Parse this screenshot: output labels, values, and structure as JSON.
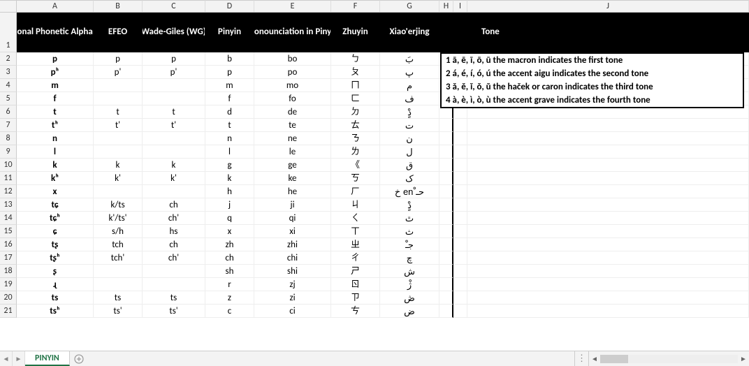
{
  "sheet": {
    "active_tab": "PINYIN"
  },
  "columns": {
    "letters": [
      "A",
      "B",
      "C",
      "D",
      "E",
      "F",
      "G",
      "H",
      "I",
      "J"
    ]
  },
  "headers": {
    "A": "International Phonetic Alphabet (IPA)",
    "B": "EFEO",
    "C": "Wade-Giles (WG)",
    "D": "Pinyin",
    "E": "Pronounciation in Pinyin",
    "F": "Zhuyin",
    "G": "Xiao'erjing",
    "J": "Tone"
  },
  "data_rows": [
    {
      "n": 2,
      "A": "p",
      "B": "p",
      "C": "p",
      "D": "b",
      "E": "bo",
      "F": "ㄅ",
      "G": "بَ"
    },
    {
      "n": 3,
      "A": "pʰ",
      "B": "p'",
      "C": "p'",
      "D": "p",
      "E": "po",
      "F": "ㄆ",
      "G": "پ"
    },
    {
      "n": 4,
      "A": "m",
      "B": "",
      "C": "",
      "D": "m",
      "E": "mo",
      "F": "ㄇ",
      "G": "م"
    },
    {
      "n": 5,
      "A": "f",
      "B": "",
      "C": "",
      "D": "f",
      "E": "fo",
      "F": "ㄈ",
      "G": "ف"
    },
    {
      "n": 6,
      "A": "t",
      "B": "t",
      "C": "t",
      "D": "d",
      "E": "de",
      "F": "ㄉ",
      "G": "دٍْ"
    },
    {
      "n": 7,
      "A": "tʰ",
      "B": "t'",
      "C": "t'",
      "D": "t",
      "E": "te",
      "F": "ㄊ",
      "G": "ت"
    },
    {
      "n": 8,
      "A": "n",
      "B": "",
      "C": "",
      "D": "n",
      "E": "ne",
      "F": "ㄋ",
      "G": "ن"
    },
    {
      "n": 9,
      "A": "l",
      "B": "",
      "C": "",
      "D": "l",
      "E": "le",
      "F": "ㄌ",
      "G": "ل"
    },
    {
      "n": 10,
      "A": "k",
      "B": "k",
      "C": "k",
      "D": "g",
      "E": "ge",
      "F": "《",
      "G": "ق"
    },
    {
      "n": 11,
      "A": "kʰ",
      "B": "k'",
      "C": "k'",
      "D": "k",
      "E": "ke",
      "F": "ㄎ",
      "G": "ک"
    },
    {
      "n": 12,
      "A": "x",
      "B": "",
      "C": "",
      "D": "h",
      "E": "he",
      "F": "ㄏ",
      "G": "خ en ْحـ"
    },
    {
      "n": 13,
      "A": "tɕ",
      "B": "k/ts",
      "C": "ch",
      "D": "j",
      "E": "ji",
      "F": "ㄐ",
      "G": "دٍْ"
    },
    {
      "n": 14,
      "A": "tɕʰ",
      "B": "k'/ts'",
      "C": "ch'",
      "D": "q",
      "E": "qi",
      "F": "ㄑ",
      "G": "ٿ"
    },
    {
      "n": 15,
      "A": "ɕ",
      "B": "s/h",
      "C": "hs",
      "D": "x",
      "E": "xi",
      "F": "ㄒ",
      "G": "ث"
    },
    {
      "n": 16,
      "A": "tʂ",
      "B": "tch",
      "C": "ch",
      "D": "zh",
      "E": "zhi",
      "F": "ㄓ",
      "G": "جـْ"
    },
    {
      "n": 17,
      "A": "tʂʰ",
      "B": "tch'",
      "C": "ch'",
      "D": "ch",
      "E": "chi",
      "F": "ㄔ",
      "G": "چ"
    },
    {
      "n": 18,
      "A": "ʂ",
      "B": "",
      "C": "",
      "D": "sh",
      "E": "shi",
      "F": "ㄕ",
      "G": "ش"
    },
    {
      "n": 19,
      "A": "ɻ",
      "B": "",
      "C": "",
      "D": "r",
      "E": "zj",
      "F": "ㄖ",
      "G": "ژْ"
    },
    {
      "n": 20,
      "A": "ts",
      "B": "ts",
      "C": "ts",
      "D": "z",
      "E": "zi",
      "F": "ㄗ",
      "G": "ڞ"
    },
    {
      "n": 21,
      "A": "tsʰ",
      "B": "ts'",
      "C": "ts'",
      "D": "c",
      "E": "ci",
      "F": "ㄘ",
      "G": "ض"
    }
  ],
  "tone_box": {
    "lines": [
      "1 ā, ē, ī, ō, ū the macron indicates the first tone",
      "2 á, é, í, ó, ú the accent aigu indicates the second tone",
      "3 ǎ, ě, ǐ, ǒ, ǔ the haček or caron indicates the third tone",
      "4 à, è, ì, ò, ù the accent grave indicates the fourth tone"
    ]
  }
}
